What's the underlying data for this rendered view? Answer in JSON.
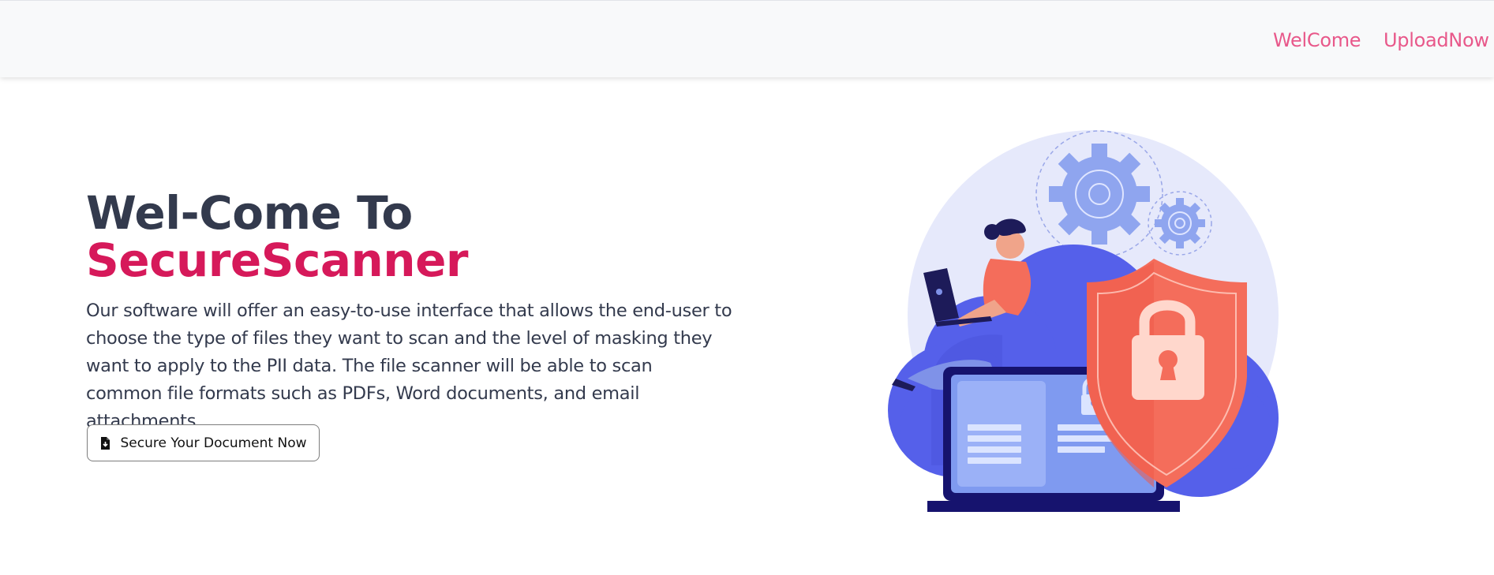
{
  "nav": {
    "links": [
      {
        "label": "WelCome"
      },
      {
        "label": "UploadNow"
      }
    ]
  },
  "hero": {
    "title_line1": "Wel-Come To",
    "title_line2": "SecureScanner",
    "description": "Our software will offer an easy-to-use interface that allows the end-user to choose the type of files they want to scan and the level of masking they want to apply to the PII data. The file scanner will be able to scan common file formats such as PDFs, Word documents, and email attachments.",
    "cta_label": "Secure Your Document Now",
    "cta_icon": "file-download-icon"
  },
  "colors": {
    "accent": "#d6195a",
    "nav_link": "#e8588a",
    "heading": "#333a4d",
    "navbar_bg": "#f8f9fa"
  }
}
